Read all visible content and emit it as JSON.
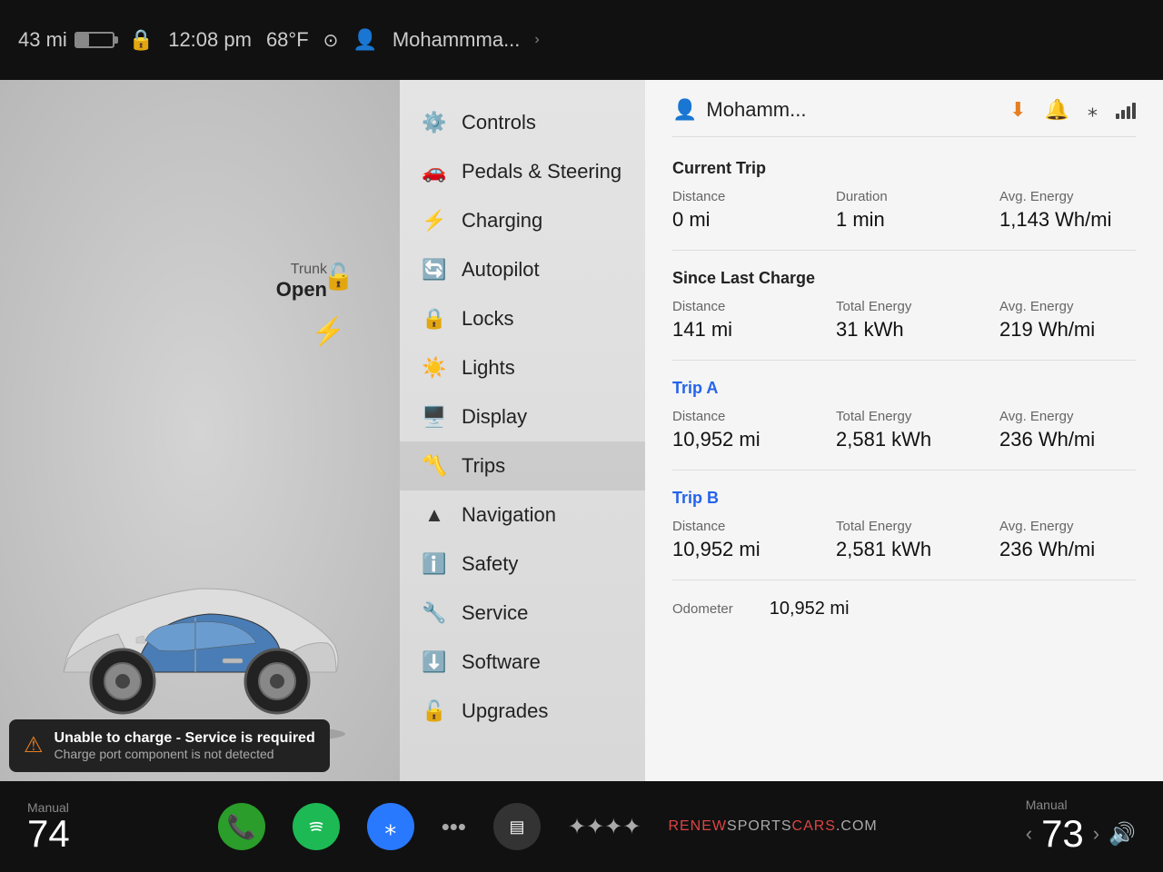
{
  "statusBar": {
    "battery": "43 mi",
    "time": "12:08 pm",
    "temp": "68°F",
    "user": "Mohammmа...",
    "chevron": "›"
  },
  "trunkInfo": {
    "label": "Trunk",
    "status": "Open"
  },
  "alert": {
    "title": "Unable to charge - Service is required",
    "subtitle": "Charge port component is not detected"
  },
  "menu": {
    "items": [
      {
        "id": "controls",
        "label": "Controls",
        "icon": "⚙"
      },
      {
        "id": "pedals",
        "label": "Pedals & Steering",
        "icon": "🚗"
      },
      {
        "id": "charging",
        "label": "Charging",
        "icon": "⚡"
      },
      {
        "id": "autopilot",
        "label": "Autopilot",
        "icon": "🔄"
      },
      {
        "id": "locks",
        "label": "Locks",
        "icon": "🔒"
      },
      {
        "id": "lights",
        "label": "Lights",
        "icon": "💡"
      },
      {
        "id": "display",
        "label": "Display",
        "icon": "🖥"
      },
      {
        "id": "trips",
        "label": "Trips",
        "icon": "📊"
      },
      {
        "id": "navigation",
        "label": "Navigation",
        "icon": "🔺"
      },
      {
        "id": "safety",
        "label": "Safety",
        "icon": "ℹ"
      },
      {
        "id": "service",
        "label": "Service",
        "icon": "🔧"
      },
      {
        "id": "software",
        "label": "Software",
        "icon": "⬇"
      },
      {
        "id": "upgrades",
        "label": "Upgrades",
        "icon": "🔓"
      }
    ]
  },
  "rightPanel": {
    "profileName": "Mohamm...",
    "currentTrip": {
      "sectionTitle": "Current Trip",
      "distance": {
        "label": "Distance",
        "value": "0 mi"
      },
      "duration": {
        "label": "Duration",
        "value": "1 min"
      },
      "avgEnergy": {
        "label": "Avg. Energy",
        "value": "1,143 Wh/mi"
      }
    },
    "sinceLastCharge": {
      "sectionTitle": "Since Last Charge",
      "distance": {
        "label": "Distance",
        "value": "141 mi"
      },
      "totalEnergy": {
        "label": "Total Energy",
        "value": "31 kWh"
      },
      "avgEnergy": {
        "label": "Avg. Energy",
        "value": "219 Wh/mi"
      }
    },
    "tripA": {
      "sectionTitle": "Trip A",
      "distance": {
        "label": "Distance",
        "value": "10,952 mi"
      },
      "totalEnergy": {
        "label": "Total Energy",
        "value": "2,581 kWh"
      },
      "avgEnergy": {
        "label": "Avg. Energy",
        "value": "236 Wh/mi"
      }
    },
    "tripB": {
      "sectionTitle": "Trip B",
      "distance": {
        "label": "Distance",
        "value": "10,952 mi"
      },
      "totalEnergy": {
        "label": "Total Energy",
        "value": "2,581 kWh"
      },
      "avgEnergy": {
        "label": "Avg. Energy",
        "value": "236 Wh/mi"
      }
    },
    "odometer": {
      "label": "Odometer",
      "value": "10,952 mi"
    }
  },
  "bottomBar": {
    "leftTemp": {
      "label": "Manual",
      "value": "74"
    },
    "rightTemp": {
      "label": "Manual",
      "value": "73"
    },
    "watermark": "RENEW SPORTS CARS.COM"
  }
}
